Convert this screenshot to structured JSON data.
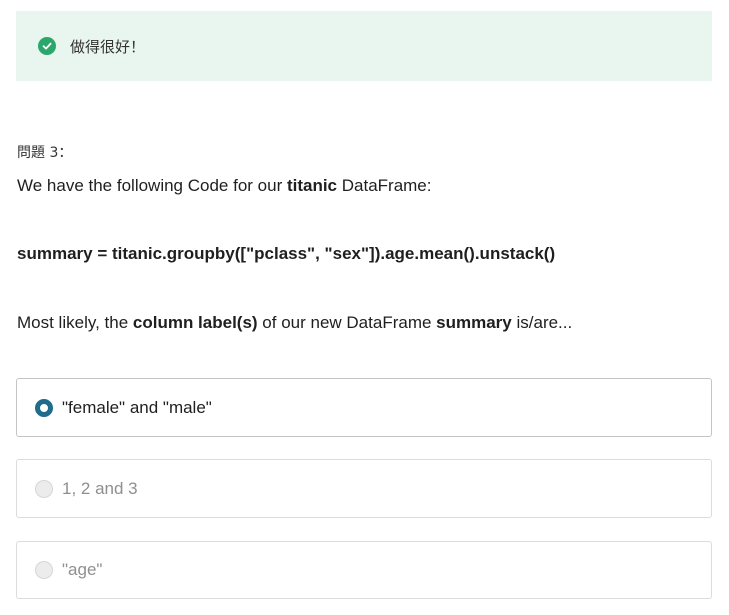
{
  "feedback": {
    "message": "做得很好！",
    "icon": "check-circle-icon",
    "color": "#2aa86b"
  },
  "question": {
    "number_label": "問題 3：",
    "line1": {
      "prefix": "We have the following Code for our ",
      "bold": "titanic",
      "suffix": " DataFrame:"
    },
    "code": "summary = titanic.groupby([\"pclass\", \"sex\"]).age.mean().unstack()",
    "line3": {
      "part1": "Most likely, the ",
      "bold1": "column label(s)",
      "part2": " of our new DataFrame ",
      "bold2": "summary",
      "part3": " is/are..."
    }
  },
  "options": [
    {
      "label": "\"female\" and \"male\"",
      "selected": true
    },
    {
      "label": "1, 2 and 3",
      "selected": false
    },
    {
      "label": "\"age\"",
      "selected": false
    }
  ],
  "colors": {
    "accent": "#1f6c8b",
    "banner_bg": "#e8f6ef"
  }
}
